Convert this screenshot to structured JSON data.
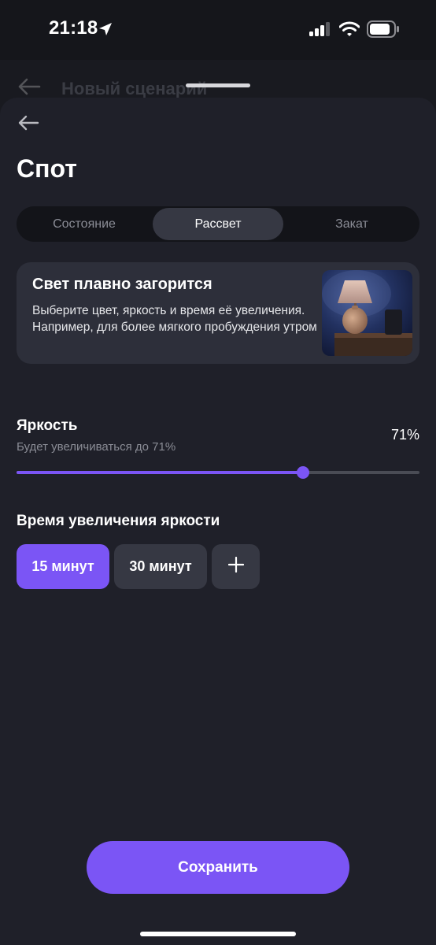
{
  "status_bar": {
    "time": "21:18"
  },
  "background_screen": {
    "title": "Новый сценарий"
  },
  "header": {
    "title": "Спот"
  },
  "tabs": [
    {
      "label": "Состояние",
      "active": false
    },
    {
      "label": "Рассвет",
      "active": true
    },
    {
      "label": "Закат",
      "active": false
    }
  ],
  "info_card": {
    "title": "Свет плавно загорится",
    "text": "Выберите цвет, яркость и время её увеличения. Например, для более мягкого пробуждения утром",
    "image": "lamp-on-nightstand"
  },
  "brightness": {
    "label": "Яркость",
    "subtitle": "Будет увеличиваться до 71%",
    "value_text": "71%",
    "value": 71
  },
  "duration": {
    "label": "Время увеличения яркости",
    "options": [
      {
        "label": "15 минут",
        "selected": true
      },
      {
        "label": "30 минут",
        "selected": false
      }
    ],
    "add_icon": "plus-icon"
  },
  "footer": {
    "save_label": "Сохранить"
  },
  "colors": {
    "accent": "#7b55f5",
    "sheet_bg": "#1f2029",
    "card_bg": "#2d2f3a",
    "chip_bg": "#363843"
  }
}
